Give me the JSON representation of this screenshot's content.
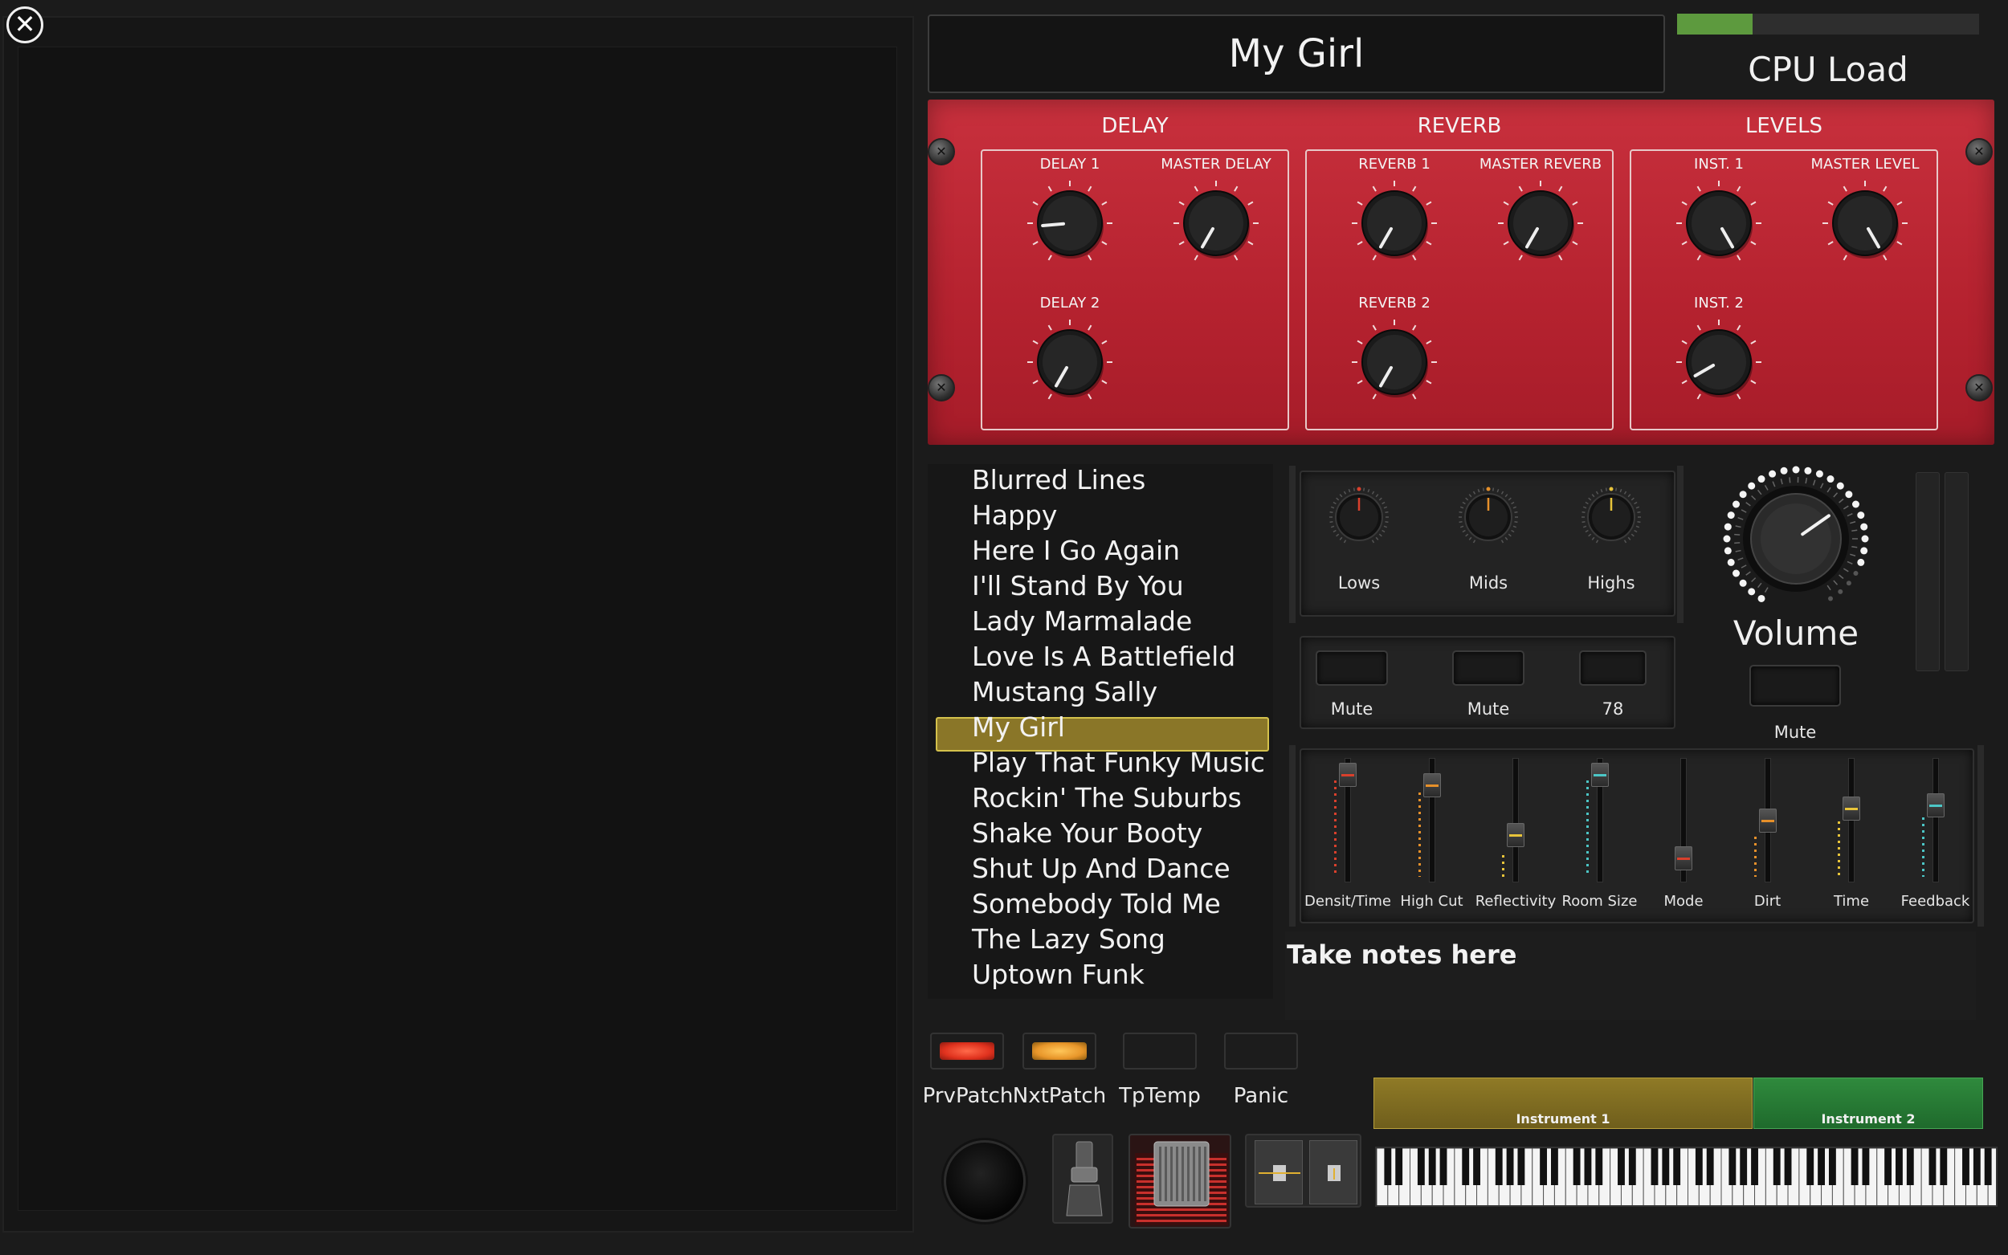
{
  "header": {
    "song_title": "My Girl",
    "cpu_label": "CPU Load",
    "cpu_load_fraction": 0.25
  },
  "sections": {
    "delay": {
      "title": "DELAY",
      "k1": "DELAY 1",
      "k2": "MASTER DELAY",
      "k3": "DELAY 2"
    },
    "reverb": {
      "title": "REVERB",
      "k1": "REVERB 1",
      "k2": "MASTER REVERB",
      "k3": "REVERB 2"
    },
    "levels": {
      "title": "LEVELS",
      "k1": "INST. 1",
      "k2": "MASTER LEVEL",
      "k3": "INST. 2"
    }
  },
  "songs": [
    "Blurred Lines",
    "Happy",
    "Here I Go Again",
    "I'll Stand By You",
    "Lady Marmalade",
    "Love Is A Battlefield",
    "Mustang Sally",
    "My Girl",
    "Play That Funky Music",
    "Rockin' The Suburbs",
    "Shake Your Booty",
    "Shut Up And Dance",
    "Somebody Told Me",
    "The Lazy Song",
    "Uptown Funk"
  ],
  "selected_song": "My Girl",
  "eq": {
    "lows": "Lows",
    "mids": "Mids",
    "highs": "Highs"
  },
  "mutes": {
    "m1": "Mute",
    "m2": "Mute",
    "m3": "78"
  },
  "volume": {
    "label": "Volume",
    "mute": "Mute"
  },
  "sliders": {
    "s1": "Densit/Time",
    "s2": "High Cut",
    "s3": "Reflectivity",
    "s4": "Room Size",
    "s5": "Mode",
    "s6": "Dirt",
    "s7": "Time",
    "s8": "Feedback"
  },
  "notes": {
    "placeholder": "Take notes here"
  },
  "footer": {
    "b1": "PrvPatch",
    "b2": "NxtPatch",
    "b3": "TpTemp",
    "b4": "Panic"
  },
  "instruments": {
    "i1": "Instrument 1",
    "i2": "Instrument 2"
  },
  "colors": {
    "cpu_fill": "#5d9a3e",
    "panel_red": "#b5222f",
    "highlight": "#8a7628",
    "inst1": "#8f7a26",
    "inst2": "#2f8a3d"
  }
}
